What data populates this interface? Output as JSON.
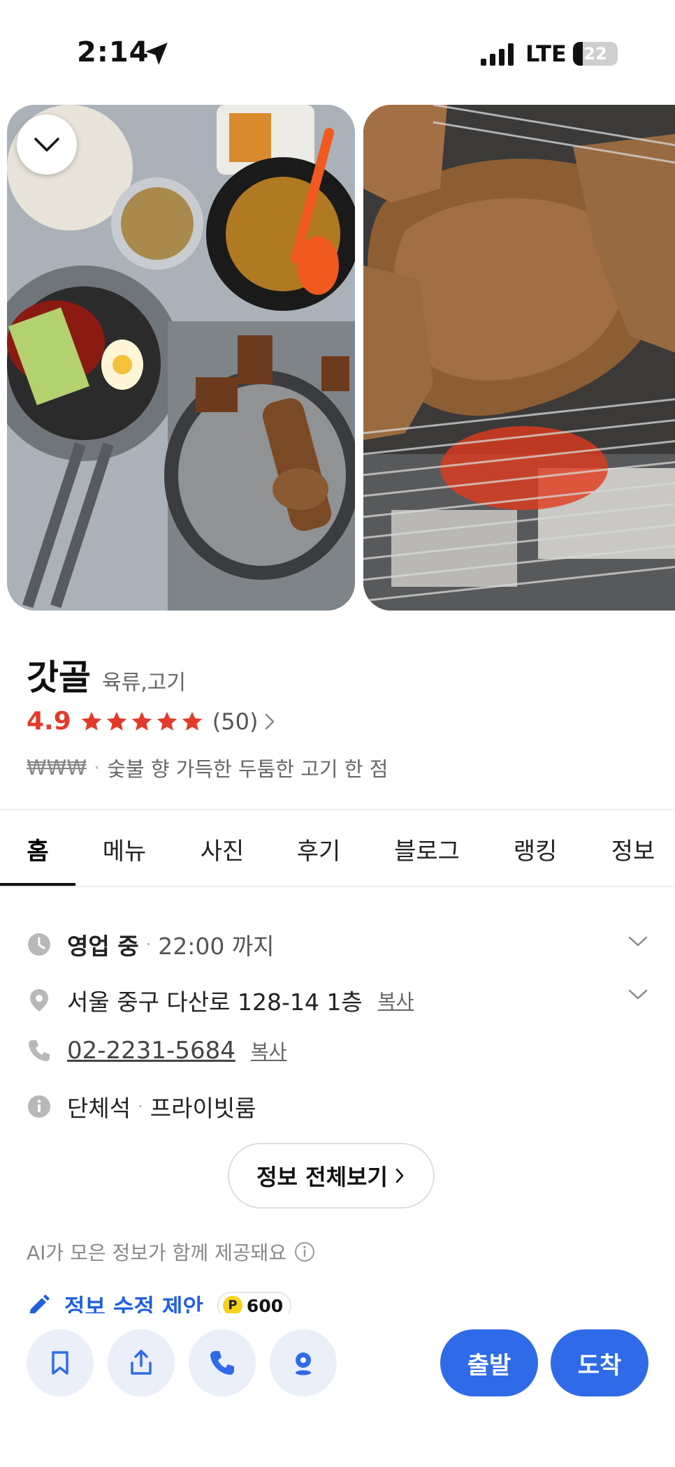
{
  "status_bar": {
    "time": "2:14",
    "network": "LTE",
    "battery": "22",
    "battery_level": 0.22
  },
  "place": {
    "name": "갓골",
    "category": "육류,고기",
    "rating": "4.9",
    "stars": 5,
    "review_count": "(50)",
    "price_level": "₩₩₩",
    "tagline": "숯불 향 가득한 두툼한 고기 한 점"
  },
  "tabs": [
    "홈",
    "메뉴",
    "사진",
    "후기",
    "블로그",
    "랭킹",
    "정보"
  ],
  "active_tab": 0,
  "info": {
    "hours_status": "영업 중",
    "hours_until": "22:00 까지",
    "address": "서울 중구 다산로 128-14 1층",
    "copy_label": "복사",
    "phone": "02-2231-5684",
    "phone_copy_label": "복사",
    "facility_1": "단체석",
    "facility_2": "프라이빗룸",
    "all_info_button": "정보 전체보기",
    "ai_note": "AI가 모은 정보가 함께 제공돼요",
    "suggest_edit": "정보 수정 제안",
    "point_symbol": "P",
    "point_value": "600"
  },
  "actions": {
    "depart": "출발",
    "arrive": "도착"
  },
  "colors": {
    "rating": "#e23b2b",
    "accent": "#2f6be8",
    "link_blue": "#1f5fe0",
    "round_button_bg": "#ebeffa"
  },
  "icons": [
    "location-arrow-icon",
    "signal-icon",
    "chevron-down-icon",
    "star-icon",
    "chevron-right-icon",
    "clock-icon",
    "map-pin-icon",
    "phone-icon",
    "info-icon",
    "pencil-icon",
    "bookmark-icon",
    "share-icon",
    "call-icon",
    "street-view-icon"
  ]
}
